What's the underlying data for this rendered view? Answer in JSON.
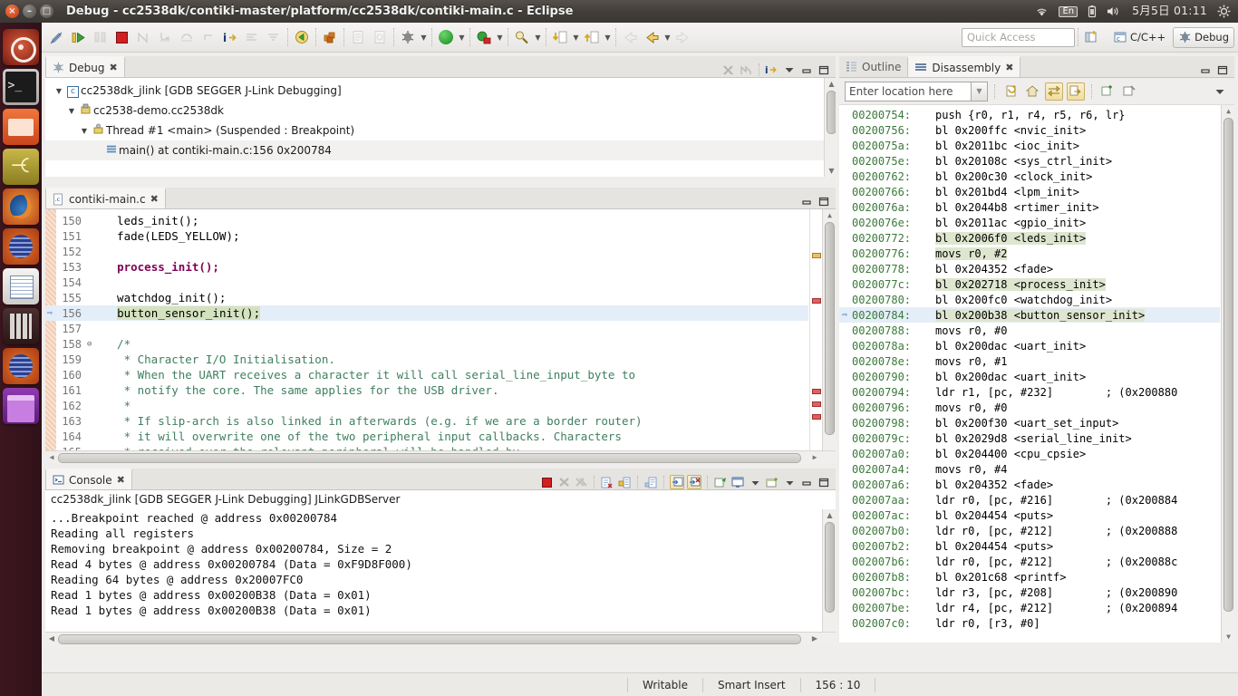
{
  "window": {
    "title": "Debug - cc2538dk/contiki-master/platform/cc2538dk/contiki-main.c - Eclipse",
    "close_glyph": "×",
    "minimize_glyph": "–",
    "maximize_glyph": "□"
  },
  "tray": {
    "wifi_icon": "wifi-icon",
    "input_method": "En",
    "battery_icon": "battery-icon",
    "volume_icon": "volume-icon",
    "clock": "5月5日 01:11",
    "settings_icon": "gear-icon"
  },
  "launcher": {
    "items": [
      {
        "name": "ubuntu-dash",
        "icon": "ubuntu-logo-icon",
        "running": false
      },
      {
        "name": "terminal",
        "icon": "terminal-icon",
        "running": true
      },
      {
        "name": "files",
        "icon": "file-manager-icon",
        "running": true
      },
      {
        "name": "gimp",
        "icon": "gimp-icon",
        "running": true
      },
      {
        "name": "firefox",
        "icon": "firefox-icon",
        "running": true
      },
      {
        "name": "eclipse",
        "icon": "eclipse-icon",
        "running": true
      },
      {
        "name": "text-editor",
        "icon": "text-editor-icon",
        "running": true
      },
      {
        "name": "calculator",
        "icon": "calculator-icon",
        "running": false
      },
      {
        "name": "eclipse-2",
        "icon": "eclipse-icon",
        "running": true,
        "focused": true
      },
      {
        "name": "workspace-switcher",
        "icon": "workspace-icon",
        "running": false
      }
    ]
  },
  "toolbar": {
    "quick_access_placeholder": "Quick Access",
    "perspectives": [
      {
        "label": "C/C++",
        "icon": "cpp-perspective-icon",
        "active": false
      },
      {
        "label": "Debug",
        "icon": "debug-perspective-icon",
        "active": true
      }
    ],
    "open_perspective_icon": "open-perspective-icon",
    "buttons": [
      {
        "name": "new-wizard",
        "icon": "pencil-icon",
        "enabled": true
      },
      {
        "name": "resume",
        "icon": "resume-icon",
        "enabled": true
      },
      {
        "name": "suspend",
        "icon": "suspend-icon",
        "enabled": false
      },
      {
        "name": "terminate",
        "icon": "terminate-icon",
        "enabled": true
      },
      {
        "name": "step-into-selection",
        "icon": "step-into-selection-icon",
        "enabled": false
      },
      {
        "name": "step-into",
        "icon": "step-into-icon",
        "enabled": true
      },
      {
        "name": "step-over",
        "icon": "step-over-icon",
        "enabled": true
      },
      {
        "name": "step-return",
        "icon": "step-return-icon",
        "enabled": false
      },
      {
        "name": "instruction-stepping",
        "icon": "instruction-stepping-icon",
        "enabled": true
      },
      {
        "name": "drop-to-frame",
        "icon": "drop-to-frame-icon",
        "enabled": false
      },
      {
        "name": "use-step-filters",
        "icon": "step-filters-icon",
        "enabled": false
      },
      {
        "name": "save",
        "icon": "save-icon",
        "enabled": true
      },
      {
        "name": "build-all",
        "icon": "build-all-icon",
        "enabled": true
      },
      {
        "name": "new-c-project",
        "icon": "new-c-project-icon",
        "enabled": false
      },
      {
        "name": "new-class",
        "icon": "new-class-icon",
        "enabled": false
      },
      {
        "name": "debug-config",
        "icon": "debug-config-icon",
        "enabled": true
      },
      {
        "name": "run",
        "icon": "run-icon",
        "enabled": true
      },
      {
        "name": "external-tools",
        "icon": "external-tools-icon",
        "enabled": true
      },
      {
        "name": "search",
        "icon": "search-icon",
        "enabled": true
      },
      {
        "name": "next-annotation",
        "icon": "next-annotation-icon",
        "enabled": true
      },
      {
        "name": "previous-annotation",
        "icon": "previous-annotation-icon",
        "enabled": true
      },
      {
        "name": "back",
        "icon": "back-arrow-icon",
        "enabled": false
      },
      {
        "name": "forward",
        "icon": "forward-arrow-icon",
        "enabled": true
      }
    ]
  },
  "debug_view": {
    "tab_label": "Debug",
    "tab_icon": "debug-icon",
    "close_glyph": "✖",
    "tools": [
      {
        "name": "remove-all-terminated",
        "icon": "remove-terminated-icon"
      },
      {
        "name": "disconnect",
        "icon": "disconnect-icon"
      },
      {
        "name": "instruction-stepping-mode",
        "icon": "instruction-stepping-icon"
      },
      {
        "name": "view-menu",
        "icon": "chevron-down-icon"
      },
      {
        "name": "minimize",
        "icon": "minimize-icon"
      },
      {
        "name": "maximize",
        "icon": "maximize-icon"
      }
    ],
    "tree": [
      {
        "indent": 0,
        "twisty": "▼",
        "icon": "launch-config-icon",
        "label": "cc2538dk_jlink [GDB SEGGER J-Link Debugging]",
        "selected": false
      },
      {
        "indent": 1,
        "twisty": "▼",
        "icon": "process-icon",
        "label": "cc2538-demo.cc2538dk",
        "selected": false
      },
      {
        "indent": 2,
        "twisty": "▼",
        "icon": "thread-icon",
        "label": "Thread #1 <main> (Suspended : Breakpoint)",
        "selected": false
      },
      {
        "indent": 3,
        "twisty": "",
        "icon": "stack-frame-icon",
        "label": "main() at contiki-main.c:156 0x200784",
        "selected": true
      }
    ]
  },
  "editor": {
    "tab_label": "contiki-main.c",
    "tab_icon": "c-file-icon",
    "close_glyph": "✖",
    "minimize_icon": "minimize-icon",
    "maximize_icon": "maximize-icon",
    "current_line": 156,
    "lines": [
      {
        "no": "150",
        "fold": "",
        "text": "  leds_init();",
        "style": "plain"
      },
      {
        "no": "151",
        "fold": "",
        "text": "  fade(LEDS_YELLOW);",
        "style": "plain"
      },
      {
        "no": "152",
        "fold": "",
        "text": "",
        "style": "plain"
      },
      {
        "no": "153",
        "fold": "",
        "text": "  process_init();",
        "style": "bold-call"
      },
      {
        "no": "154",
        "fold": "",
        "text": "",
        "style": "plain"
      },
      {
        "no": "155",
        "fold": "",
        "text": "  watchdog_init();",
        "style": "plain"
      },
      {
        "no": "156",
        "fold": "",
        "text": "  button_sensor_init();",
        "style": "exec"
      },
      {
        "no": "157",
        "fold": "",
        "text": "",
        "style": "plain"
      },
      {
        "no": "158",
        "fold": "⊖",
        "text": "  /*",
        "style": "comment"
      },
      {
        "no": "159",
        "fold": "",
        "text": "   * Character I/O Initialisation.",
        "style": "comment"
      },
      {
        "no": "160",
        "fold": "",
        "text": "   * When the UART receives a character it will call serial_line_input_byte to",
        "style": "comment"
      },
      {
        "no": "161",
        "fold": "",
        "text": "   * notify the core. The same applies for the USB driver.",
        "style": "comment"
      },
      {
        "no": "162",
        "fold": "",
        "text": "   *",
        "style": "comment"
      },
      {
        "no": "163",
        "fold": "",
        "text": "   * If slip-arch is also linked in afterwards (e.g. if we are a border router)",
        "style": "comment"
      },
      {
        "no": "164",
        "fold": "",
        "text": "   * it will overwrite one of the two peripheral input callbacks. Characters",
        "style": "comment"
      },
      {
        "no": "165",
        "fold": "",
        "text": "   * received over the relevant peripheral will be handled by",
        "style": "comment"
      }
    ]
  },
  "disassembly": {
    "tabs": [
      {
        "label": "Outline",
        "icon": "outline-icon",
        "active": false
      },
      {
        "label": "Disassembly",
        "icon": "disassembly-icon",
        "active": true
      }
    ],
    "close_glyph": "✖",
    "minimize_icon": "minimize-icon",
    "maximize_icon": "maximize-icon",
    "location_placeholder": "Enter location here",
    "location_dropdown_icon": "chevron-down-icon",
    "tools": [
      {
        "name": "refresh-view",
        "icon": "refresh-icon",
        "active": false
      },
      {
        "name": "home",
        "icon": "home-icon",
        "active": false
      },
      {
        "name": "show-source",
        "icon": "show-source-icon",
        "active": true
      },
      {
        "name": "show-symbols",
        "icon": "show-symbols-icon",
        "active": true
      },
      {
        "name": "new-view",
        "icon": "new-view-icon",
        "active": false
      },
      {
        "name": "pin-view",
        "icon": "pin-view-icon",
        "active": false
      },
      {
        "name": "view-menu",
        "icon": "chevron-down-icon",
        "active": false
      }
    ],
    "current_address": "00200784",
    "rows": [
      {
        "addr": "00200754:",
        "ins": "push {r0, r1, r4, r5, r6, lr}",
        "hl": false,
        "cur": false
      },
      {
        "addr": "00200756:",
        "ins": "bl 0x200ffc <nvic_init>",
        "hl": false,
        "cur": false
      },
      {
        "addr": "0020075a:",
        "ins": "bl 0x2011bc <ioc_init>",
        "hl": false,
        "cur": false
      },
      {
        "addr": "0020075e:",
        "ins": "bl 0x20108c <sys_ctrl_init>",
        "hl": false,
        "cur": false
      },
      {
        "addr": "00200762:",
        "ins": "bl 0x200c30 <clock_init>",
        "hl": false,
        "cur": false
      },
      {
        "addr": "00200766:",
        "ins": "bl 0x201bd4 <lpm_init>",
        "hl": false,
        "cur": false
      },
      {
        "addr": "0020076a:",
        "ins": "bl 0x2044b8 <rtimer_init>",
        "hl": false,
        "cur": false
      },
      {
        "addr": "0020076e:",
        "ins": "bl 0x2011ac <gpio_init>",
        "hl": false,
        "cur": false
      },
      {
        "addr": "00200772:",
        "ins": "bl 0x2006f0 <leds_init>",
        "hl": true,
        "cur": false
      },
      {
        "addr": "00200776:",
        "ins": "movs r0, #2",
        "hl": true,
        "cur": false
      },
      {
        "addr": "00200778:",
        "ins": "bl 0x204352 <fade>",
        "hl": false,
        "cur": false
      },
      {
        "addr": "0020077c:",
        "ins": "bl 0x202718 <process_init>",
        "hl": true,
        "cur": false
      },
      {
        "addr": "00200780:",
        "ins": "bl 0x200fc0 <watchdog_init>",
        "hl": false,
        "cur": false
      },
      {
        "addr": "00200784:",
        "ins": "bl 0x200b38 <button_sensor_init>",
        "hl": true,
        "cur": true
      },
      {
        "addr": "00200788:",
        "ins": "movs r0, #0",
        "hl": false,
        "cur": false
      },
      {
        "addr": "0020078a:",
        "ins": "bl 0x200dac <uart_init>",
        "hl": false,
        "cur": false
      },
      {
        "addr": "0020078e:",
        "ins": "movs r0, #1",
        "hl": false,
        "cur": false
      },
      {
        "addr": "00200790:",
        "ins": "bl 0x200dac <uart_init>",
        "hl": false,
        "cur": false
      },
      {
        "addr": "00200794:",
        "ins": "ldr r1, [pc, #232]        ; (0x200880",
        "hl": false,
        "cur": false
      },
      {
        "addr": "00200796:",
        "ins": "movs r0, #0",
        "hl": false,
        "cur": false
      },
      {
        "addr": "00200798:",
        "ins": "bl 0x200f30 <uart_set_input>",
        "hl": false,
        "cur": false
      },
      {
        "addr": "0020079c:",
        "ins": "bl 0x2029d8 <serial_line_init>",
        "hl": false,
        "cur": false
      },
      {
        "addr": "002007a0:",
        "ins": "bl 0x204400 <cpu_cpsie>",
        "hl": false,
        "cur": false
      },
      {
        "addr": "002007a4:",
        "ins": "movs r0, #4",
        "hl": false,
        "cur": false
      },
      {
        "addr": "002007a6:",
        "ins": "bl 0x204352 <fade>",
        "hl": false,
        "cur": false
      },
      {
        "addr": "002007aa:",
        "ins": "ldr r0, [pc, #216]        ; (0x200884",
        "hl": false,
        "cur": false
      },
      {
        "addr": "002007ac:",
        "ins": "bl 0x204454 <puts>",
        "hl": false,
        "cur": false
      },
      {
        "addr": "002007b0:",
        "ins": "ldr r0, [pc, #212]        ; (0x200888",
        "hl": false,
        "cur": false
      },
      {
        "addr": "002007b2:",
        "ins": "bl 0x204454 <puts>",
        "hl": false,
        "cur": false
      },
      {
        "addr": "002007b6:",
        "ins": "ldr r0, [pc, #212]        ; (0x20088c",
        "hl": false,
        "cur": false
      },
      {
        "addr": "002007b8:",
        "ins": "bl 0x201c68 <printf>",
        "hl": false,
        "cur": false
      },
      {
        "addr": "002007bc:",
        "ins": "ldr r3, [pc, #208]        ; (0x200890",
        "hl": false,
        "cur": false
      },
      {
        "addr": "002007be:",
        "ins": "ldr r4, [pc, #212]        ; (0x200894",
        "hl": false,
        "cur": false
      },
      {
        "addr": "002007c0:",
        "ins": "ldr r0, [r3, #0]",
        "hl": false,
        "cur": false
      }
    ]
  },
  "console": {
    "tab_label": "Console",
    "tab_icon": "console-icon",
    "close_glyph": "✖",
    "title": "cc2538dk_jlink [GDB SEGGER J-Link Debugging] JLinkGDBServer",
    "tools": [
      {
        "name": "terminate",
        "icon": "terminate-icon",
        "enabled": true
      },
      {
        "name": "remove-launch",
        "icon": "remove-launch-icon",
        "enabled": false
      },
      {
        "name": "remove-all-launches",
        "icon": "remove-all-launches-icon",
        "enabled": false
      },
      {
        "name": "clear-console",
        "icon": "clear-console-icon",
        "enabled": true
      },
      {
        "name": "scroll-lock",
        "icon": "scroll-lock-icon",
        "enabled": true
      },
      {
        "name": "word-wrap",
        "icon": "word-wrap-icon",
        "enabled": true
      },
      {
        "name": "show-console-on-output",
        "icon": "show-console-output-icon",
        "enabled": true,
        "active": true
      },
      {
        "name": "show-console-on-error",
        "icon": "show-console-error-icon",
        "enabled": true,
        "active": true
      },
      {
        "name": "pin-console",
        "icon": "pin-console-icon",
        "enabled": true
      },
      {
        "name": "display-selected-console",
        "icon": "display-console-icon",
        "enabled": true
      },
      {
        "name": "display-console-menu",
        "icon": "chevron-down-icon",
        "enabled": true
      },
      {
        "name": "open-console",
        "icon": "open-console-icon",
        "enabled": true
      },
      {
        "name": "open-console-menu",
        "icon": "chevron-down-icon",
        "enabled": true
      },
      {
        "name": "minimize",
        "icon": "minimize-icon",
        "enabled": true
      },
      {
        "name": "maximize",
        "icon": "maximize-icon",
        "enabled": true
      }
    ],
    "lines": [
      "...Breakpoint reached @ address 0x00200784",
      "Reading all registers",
      "Removing breakpoint @ address 0x00200784, Size = 2",
      "Read 4 bytes @ address 0x00200784 (Data = 0xF9D8F000)",
      "Reading 64 bytes @ address 0x20007FC0",
      "Read 1 bytes @ address 0x00200B38 (Data = 0x01)",
      "Read 1 bytes @ address 0x00200B38 (Data = 0x01)"
    ]
  },
  "statusbar": {
    "writable": "Writable",
    "insert_mode": "Smart Insert",
    "cursor_position": "156 : 10"
  },
  "colors": {
    "accent": "#3b6ea5",
    "exec_line_highlight": "#d4e3bf",
    "current_row_highlight": "#e4eef8",
    "comment_green": "#3f7f5f",
    "keyword_purple": "#7f0055",
    "address_green": "#3a7a3a"
  }
}
